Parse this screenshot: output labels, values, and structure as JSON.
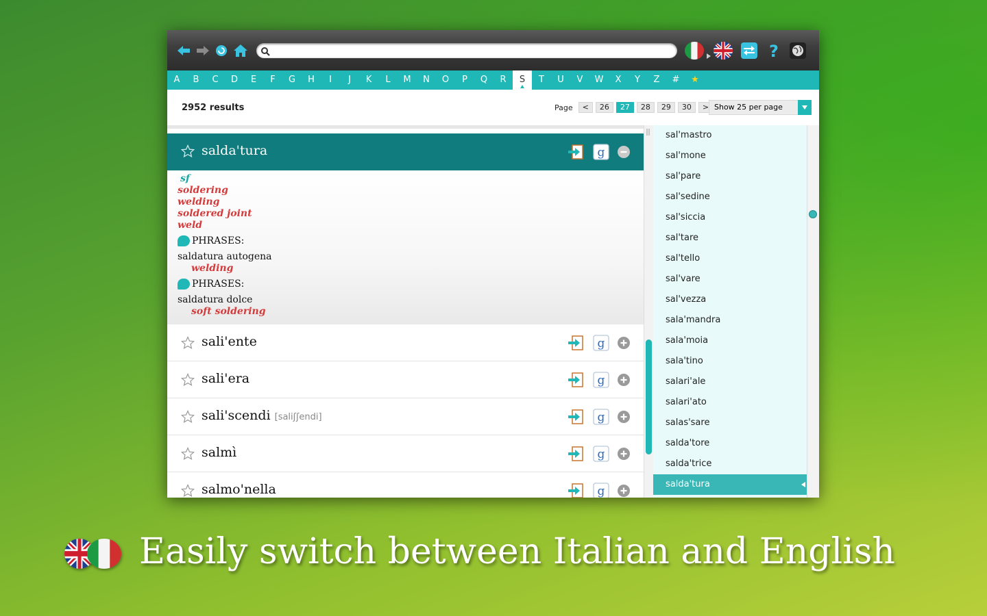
{
  "toolbar": {
    "search_value": "",
    "search_placeholder": "",
    "icons": [
      "back-arrow-icon",
      "forward-arrow-icon",
      "refresh-icon",
      "home-icon",
      "italian-flag-icon",
      "english-flag-icon",
      "swap-language-icon",
      "help-icon",
      "globe-icon"
    ]
  },
  "alphabet": [
    "A",
    "B",
    "C",
    "D",
    "E",
    "F",
    "G",
    "H",
    "I",
    "J",
    "K",
    "L",
    "M",
    "N",
    "O",
    "P",
    "Q",
    "R",
    "S",
    "T",
    "U",
    "V",
    "W",
    "X",
    "Y",
    "Z",
    "#",
    "★"
  ],
  "alphabet_active": "S",
  "results": {
    "count_label": "2952 results",
    "page_label": "Page",
    "prev": "<",
    "next": ">",
    "pages": [
      "26",
      "27",
      "28",
      "29",
      "30"
    ],
    "active_page": "27",
    "per_page_label": "Show 25 per page"
  },
  "expanded_entry": {
    "word": "salda'tura",
    "pos": "sf",
    "translations": [
      "soldering",
      "welding",
      "soldered joint",
      "weld"
    ],
    "phrases_label": "PHRASES:",
    "phrases": [
      {
        "phrase": "saldatura autogena",
        "translation": "welding"
      },
      {
        "phrase": "saldatura dolce",
        "translation": "soft soldering"
      }
    ]
  },
  "entries": [
    {
      "word": "sali'ente",
      "ipa": ""
    },
    {
      "word": "sali'era",
      "ipa": ""
    },
    {
      "word": "sali'scendi",
      "ipa": "[saliʃʃendi]"
    },
    {
      "word": "salmì",
      "ipa": ""
    },
    {
      "word": "salmo'nella",
      "ipa": ""
    }
  ],
  "sidebar": {
    "items": [
      "sal'mastro",
      "sal'mone",
      "sal'pare",
      "sal'sedine",
      "sal'siccia",
      "sal'tare",
      "sal'tello",
      "sal'vare",
      "sal'vezza",
      "sala'mandra",
      "sala'moia",
      "sala'tino",
      "salari'ale",
      "salari'ato",
      "salas'sare",
      "salda'tore",
      "salda'trice",
      "salda'tura"
    ],
    "active": "salda'tura"
  },
  "caption": "Easily switch between Italian and English",
  "colors": {
    "accent": "#20b8b6",
    "header_dark": "#117c7d",
    "translation": "#d33c3c"
  }
}
